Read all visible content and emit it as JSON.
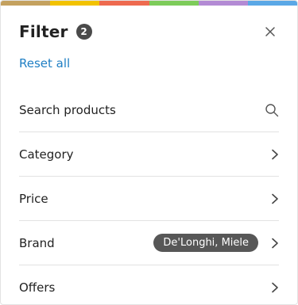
{
  "brand_strip_colors": [
    "#c4a15f",
    "#f2c200",
    "#ee6a4f",
    "#7dcc5a",
    "#b38ad4",
    "#5aa8e6"
  ],
  "header": {
    "title": "Filter",
    "active_count": "2"
  },
  "actions": {
    "reset_all": "Reset all"
  },
  "rows": [
    {
      "label": "Search products",
      "icon": "search-icon"
    },
    {
      "label": "Category",
      "icon": "chevron-right-icon"
    },
    {
      "label": "Price",
      "icon": "chevron-right-icon"
    },
    {
      "label": "Brand",
      "selected": "De'Longhi, Miele",
      "icon": "chevron-right-icon"
    },
    {
      "label": "Offers",
      "icon": "chevron-right-icon"
    }
  ]
}
